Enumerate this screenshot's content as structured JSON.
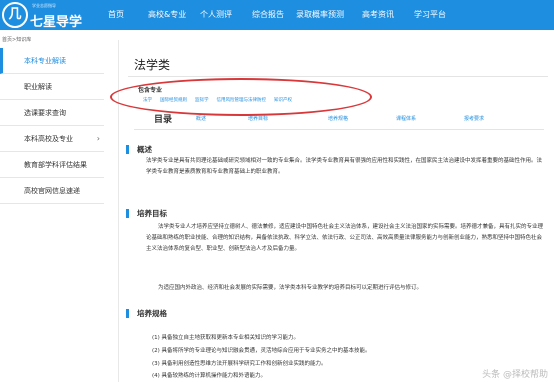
{
  "header": {
    "logo_mark": "几",
    "logo_text": "七星导学",
    "logo_sub": "学业志愿指导",
    "nav": [
      "首页",
      "高校&专业",
      "个人测评",
      "综合报告",
      "录取概率预测",
      "高考资讯",
      "学习平台"
    ]
  },
  "breadcrumb": "首页>知识库",
  "sidebar": {
    "items": [
      {
        "label": "本科专业解读",
        "active": true
      },
      {
        "label": "职业解读",
        "active": false
      },
      {
        "label": "选课要求查询",
        "active": false
      },
      {
        "label": "本科高校及专业",
        "active": false,
        "arrow": "›"
      },
      {
        "label": "教育部学科评估结果",
        "active": false
      },
      {
        "label": "高校官网信息速递",
        "active": false
      }
    ]
  },
  "main": {
    "title": "法学类",
    "includes_label": "包含专业",
    "majors": [
      "法学",
      "国际经贸规则",
      "监狱学",
      "信用风险管理与法律防控",
      "知识产权"
    ],
    "toc": {
      "label": "目录",
      "links": [
        "概述",
        "培养目标",
        "培养规格",
        "课程体系",
        "报考要求"
      ]
    },
    "sections": {
      "overview": {
        "heading": "概述",
        "text": "法学类专业是具有共同理论基础或研究领域相对一致的专业集合。法学类专业教育具有很强的应用性和实践性，在国家民主法治建设中发挥着重要的基础性作用。法学类专业教育是素质教育和专业教育基础上的职业教育。"
      },
      "objectives": {
        "heading": "培养目标",
        "para1": "法学类专业人才培养应坚持立德树人、德法兼修，适应建设中国特色社会主义法治体系，建设社会主义法治国家的实际需要。培养德才兼备，具有扎实的专业理论基础和熟练的职业技能、合理的知识结构，具备依法执政、科学立法、依法行政、公正司法、高效高质量法律服务能力与创新创业能力，熟悉和坚持中国特色社会主义法治体系的复合型、职业型、创新型法治人才及后备力量。",
        "para2": "为适应国内外政治、经济和社会发展的实际需要，法学类本科专业教学的培养目标可以定期进行评估与修订。"
      },
      "specs": {
        "heading": "培养规格",
        "items": [
          "(1) 具备独立自主地获取和更新本专业相关知识的学习能力。",
          "(2) 具备将所学的专业理论与知识融会贯通，灵活地综合应用于专业实务之中的基本技能。",
          "(3) 具备利用创造性思维方法开展科学研究工作和创新创业实践的能力。",
          "(4) 具备较熟练的计算机操作能力和外语能力。"
        ]
      }
    }
  },
  "watermark": "头条 @择校帮助",
  "colors": {
    "nav_bg": "#1e8ee0",
    "accent": "#1e8ee0",
    "annotation": "#d9383a"
  }
}
